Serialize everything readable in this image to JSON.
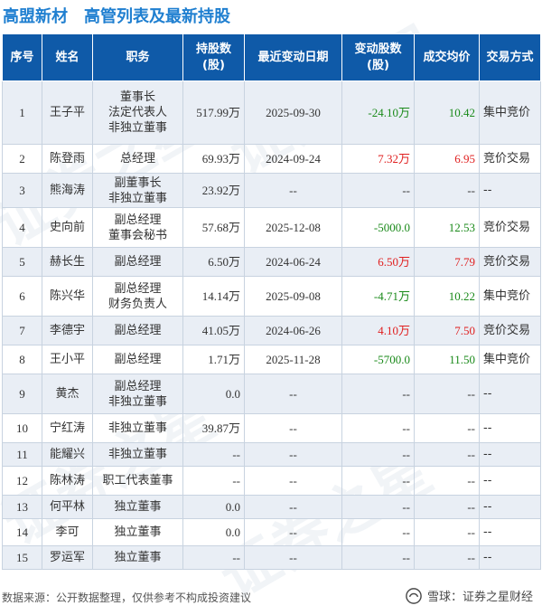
{
  "header": {
    "company": "高盟新材",
    "title": "高管列表及最新持股"
  },
  "table": {
    "columns": [
      "序号",
      "姓名",
      "职务",
      "持股数\n(股)",
      "最近变动日期",
      "变动股数\n(股)",
      "成交均价",
      "交易方式"
    ],
    "rows": [
      {
        "no": "1",
        "name": "王子平",
        "role": "董事长\n法定代表人\n非独立董事",
        "shares": "517.99万",
        "date": "2025-09-30",
        "change": "-24.10万",
        "change_sign": "neg",
        "price": "10.42",
        "price_sign": "neg",
        "method": "集中竞价"
      },
      {
        "no": "2",
        "name": "陈登雨",
        "role": "总经理",
        "shares": "69.93万",
        "date": "2024-09-24",
        "change": "7.32万",
        "change_sign": "pos",
        "price": "6.95",
        "price_sign": "pos",
        "method": "竞价交易"
      },
      {
        "no": "3",
        "name": "熊海涛",
        "role": "副董事长\n非独立董事",
        "shares": "23.92万",
        "date": "--",
        "change": "--",
        "change_sign": "none",
        "price": "--",
        "price_sign": "none",
        "method": "--"
      },
      {
        "no": "4",
        "name": "史向前",
        "role": "副总经理\n董事会秘书",
        "shares": "57.68万",
        "date": "2025-12-08",
        "change": "-5000.0",
        "change_sign": "neg",
        "price": "12.53",
        "price_sign": "neg",
        "method": "竞价交易"
      },
      {
        "no": "5",
        "name": "赫长生",
        "role": "副总经理",
        "shares": "6.50万",
        "date": "2024-06-24",
        "change": "6.50万",
        "change_sign": "pos",
        "price": "7.79",
        "price_sign": "pos",
        "method": "竞价交易"
      },
      {
        "no": "6",
        "name": "陈兴华",
        "role": "副总经理\n财务负责人",
        "shares": "14.14万",
        "date": "2025-09-08",
        "change": "-4.71万",
        "change_sign": "neg",
        "price": "10.22",
        "price_sign": "neg",
        "method": "集中竞价"
      },
      {
        "no": "7",
        "name": "李德宇",
        "role": "副总经理",
        "shares": "41.05万",
        "date": "2024-06-26",
        "change": "4.10万",
        "change_sign": "pos",
        "price": "7.50",
        "price_sign": "pos",
        "method": "竞价交易"
      },
      {
        "no": "8",
        "name": "王小平",
        "role": "副总经理",
        "shares": "1.71万",
        "date": "2025-11-28",
        "change": "-5700.0",
        "change_sign": "neg",
        "price": "11.50",
        "price_sign": "neg",
        "method": "集中竞价"
      },
      {
        "no": "9",
        "name": "黄杰",
        "role": "副总经理\n非独立董事",
        "shares": "0.0",
        "date": "--",
        "change": "--",
        "change_sign": "none",
        "price": "--",
        "price_sign": "none",
        "method": "--"
      },
      {
        "no": "10",
        "name": "宁红涛",
        "role": "非独立董事",
        "shares": "39.87万",
        "date": "--",
        "change": "--",
        "change_sign": "none",
        "price": "--",
        "price_sign": "none",
        "method": "--"
      },
      {
        "no": "11",
        "name": "能耀兴",
        "role": "非独立董事",
        "shares": "--",
        "date": "--",
        "change": "--",
        "change_sign": "none",
        "price": "--",
        "price_sign": "none",
        "method": "--"
      },
      {
        "no": "12",
        "name": "陈林涛",
        "role": "职工代表董事",
        "shares": "--",
        "date": "--",
        "change": "--",
        "change_sign": "none",
        "price": "--",
        "price_sign": "none",
        "method": "--"
      },
      {
        "no": "13",
        "name": "何平林",
        "role": "独立董事",
        "shares": "0.0",
        "date": "--",
        "change": "--",
        "change_sign": "none",
        "price": "--",
        "price_sign": "none",
        "method": "--"
      },
      {
        "no": "14",
        "name": "李可",
        "role": "独立董事",
        "shares": "0.0",
        "date": "--",
        "change": "--",
        "change_sign": "none",
        "price": "--",
        "price_sign": "none",
        "method": "--"
      },
      {
        "no": "15",
        "name": "罗运军",
        "role": "独立董事",
        "shares": "--",
        "date": "--",
        "change": "--",
        "change_sign": "none",
        "price": "--",
        "price_sign": "none",
        "method": "--"
      }
    ]
  },
  "footer": {
    "source": "数据来源：公开数据整理，仅供参考不构成投资建议",
    "brand": "雪球：证券之星财经"
  },
  "watermark": "证券之星",
  "colors": {
    "title": "#1f7fd0",
    "header_bg": "#0f5aa8",
    "positive": "#e02020",
    "negative": "#1a8a1a"
  }
}
